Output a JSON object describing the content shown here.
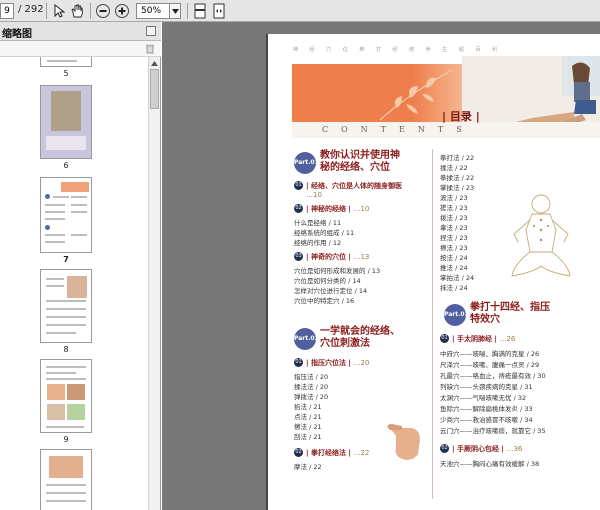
{
  "toolbar": {
    "page_value": "9",
    "page_total": "/ 292",
    "zoom_value": "50%",
    "colors": {
      "background": "#e6e6e6",
      "border": "#a8a8a8"
    }
  },
  "sidebar": {
    "panel_title": "缩略图",
    "thumbnails": [
      {
        "label": "5"
      },
      {
        "label": "6"
      },
      {
        "label": "7"
      },
      {
        "label": "8"
      },
      {
        "label": "9"
      },
      {
        "label": ""
      }
    ]
  },
  "document": {
    "header_text": "神 经 穴 位 拳 打 经 络 养 生 超 百 科",
    "mulu_title": "目录",
    "contents_word": "CONTENTS",
    "left_column": {
      "part1": {
        "badge": "Part.01",
        "title_line1": "教你认识并使用神",
        "title_line2": "秘的经络、穴位"
      },
      "sec1": {
        "num": "01",
        "title": "经络、穴位是人体的随身御医",
        "page": "…10"
      },
      "sec1_sub": {
        "num": "02",
        "title": "神秘的经络",
        "page": "…10"
      },
      "sec1_items": [
        "什么是经络 / 11",
        "经络系统的组成 / 11",
        "经络的作用 / 12"
      ],
      "sec3": {
        "num": "03",
        "title": "神奇的穴位",
        "page": "…13"
      },
      "sec3_items": [
        "穴位是如何形成和发展的 / 13",
        "穴位是如何分类的 / 14",
        "怎样对穴位进行定位 / 14",
        "穴位中的特定穴 / 16"
      ],
      "part2": {
        "badge": "Part.02",
        "title_line1": "一学就会的经络、",
        "title_line2": "穴位刺激法"
      },
      "sec4": {
        "num": "01",
        "title": "指压穴位法",
        "page": "…20"
      },
      "sec4_items": [
        "指压法 / 20",
        "揉法法 / 20",
        "弹拨法 / 20",
        "掐法 / 21",
        "点法 / 21",
        "擦法 / 21",
        "刮法 / 21"
      ],
      "sec5": {
        "num": "02",
        "title": "拳打经络法",
        "page": "…22"
      },
      "sec5_items": [
        "摩法 / 22"
      ]
    },
    "right_column": {
      "top_items": [
        "拳打法 / 22",
        "揉法 / 22",
        "拳揉法 / 22",
        "掌揉法 / 23",
        "滚法 / 23",
        "搓法 / 23",
        "拨法 / 23",
        "拿法 / 23",
        "捏法 / 23",
        "擦法 / 23",
        "按法 / 24",
        "推法 / 24",
        "掌拍法 / 24",
        "抹法 / 24"
      ],
      "part3": {
        "badge": "Part.03",
        "title_line1": "拳打十四经、指压",
        "title_line2": "特效穴"
      },
      "sec6": {
        "num": "01",
        "title": "手太阴肺经",
        "page": "…26"
      },
      "sec6_items": [
        "中府穴——咳喘、胸满的克星 / 26",
        "尺泽穴——咳嗽、腹痛一点灵 / 29",
        "孔最穴——咯血止，痔疮最有效 / 30",
        "列缺穴——头颈疾病的克星 / 31",
        "太渊穴——气喘咳嗽无忧 / 32",
        "鱼际穴——解除扁桃体发炎 / 33",
        "少商穴——救治感冒不咳嗽 / 34",
        "云门穴——治疗咳嗽痰，就靠它 / 35"
      ],
      "sec7": {
        "num": "02",
        "title": "手厥阴心包经",
        "page": "…36"
      },
      "sec7_items": [
        "天池穴——胸闷心痛有效缓解 / 38"
      ]
    }
  }
}
